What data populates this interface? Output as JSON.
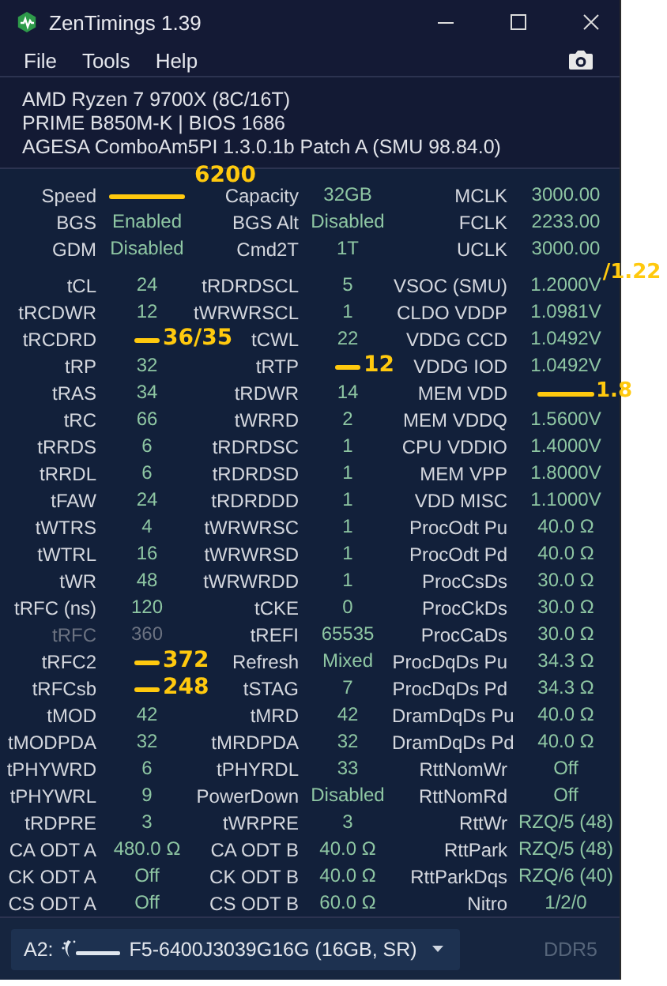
{
  "window": {
    "title": "ZenTimings 1.39"
  },
  "menu": [
    "File",
    "Tools",
    "Help"
  ],
  "system_info": [
    "AMD Ryzen 7 9700X (8C/16T)",
    "PRIME B850M-K | BIOS 1686",
    "AGESA ComboAm5PI 1.3.0.1b Patch A (SMU 98.84.0)"
  ],
  "summary_rows": [
    [
      {
        "label": "Speed",
        "kind": "struck",
        "note": "6200"
      },
      {
        "label": "Capacity",
        "value": "32GB",
        "kind": "plain"
      },
      {
        "label": "MCLK",
        "value": "3000.00",
        "kind": "plain"
      }
    ],
    [
      {
        "label": "BGS",
        "value": "Enabled",
        "kind": "plain"
      },
      {
        "label": "BGS Alt",
        "value": "Disabled",
        "kind": "plain"
      },
      {
        "label": "FCLK",
        "value": "2233.00",
        "kind": "plain"
      }
    ],
    [
      {
        "label": "GDM",
        "value": "Disabled",
        "kind": "plain"
      },
      {
        "label": "Cmd2T",
        "value": "1T",
        "kind": "plain"
      },
      {
        "label": "UCLK",
        "value": "3000.00",
        "kind": "plain"
      }
    ]
  ],
  "timing_rows": [
    [
      {
        "label": "tCL",
        "value": "24",
        "kind": "plain"
      },
      {
        "label": "tRDRDSCL",
        "value": "5",
        "kind": "plain"
      },
      {
        "label": "VSOC (SMU)",
        "value": "1.2000V",
        "kind": "plain",
        "note": "/1.22"
      }
    ],
    [
      {
        "label": "tRCDWR",
        "value": "12",
        "kind": "plain"
      },
      {
        "label": "tWRWRSCL",
        "value": "1",
        "kind": "plain"
      },
      {
        "label": "CLDO VDDP",
        "value": "1.0981V",
        "kind": "plain"
      }
    ],
    [
      {
        "label": "tRCDRD",
        "kind": "struck",
        "note": "36/35"
      },
      {
        "label": "tCWL",
        "value": "22",
        "kind": "plain"
      },
      {
        "label": "VDDG CCD",
        "value": "1.0492V",
        "kind": "plain"
      }
    ],
    [
      {
        "label": "tRP",
        "value": "32",
        "kind": "plain"
      },
      {
        "label": "tRTP",
        "kind": "struck",
        "note": "12"
      },
      {
        "label": "VDDG IOD",
        "value": "1.0492V",
        "kind": "plain"
      }
    ],
    [
      {
        "label": "tRAS",
        "value": "34",
        "kind": "plain"
      },
      {
        "label": "tRDWR",
        "value": "14",
        "kind": "plain"
      },
      {
        "label": "MEM VDD",
        "kind": "struck",
        "note": "1.8"
      }
    ],
    [
      {
        "label": "tRC",
        "value": "66",
        "kind": "plain"
      },
      {
        "label": "tWRRD",
        "value": "2",
        "kind": "plain"
      },
      {
        "label": "MEM VDDQ",
        "value": "1.5600V",
        "kind": "plain"
      }
    ],
    [
      {
        "label": "tRRDS",
        "value": "6",
        "kind": "plain"
      },
      {
        "label": "tRDRDSC",
        "value": "1",
        "kind": "plain"
      },
      {
        "label": "CPU VDDIO",
        "value": "1.4000V",
        "kind": "plain"
      }
    ],
    [
      {
        "label": "tRRDL",
        "value": "6",
        "kind": "plain"
      },
      {
        "label": "tRDRDSD",
        "value": "1",
        "kind": "plain"
      },
      {
        "label": "MEM VPP",
        "value": "1.8000V",
        "kind": "plain"
      }
    ],
    [
      {
        "label": "tFAW",
        "value": "24",
        "kind": "plain"
      },
      {
        "label": "tRDRDDD",
        "value": "1",
        "kind": "plain"
      },
      {
        "label": "VDD MISC",
        "value": "1.1000V",
        "kind": "plain"
      }
    ],
    [
      {
        "label": "tWTRS",
        "value": "4",
        "kind": "plain"
      },
      {
        "label": "tWRWRSC",
        "value": "1",
        "kind": "plain"
      },
      {
        "label": "ProcOdt Pu",
        "value": "40.0 Ω",
        "kind": "plain"
      }
    ],
    [
      {
        "label": "tWTRL",
        "value": "16",
        "kind": "plain"
      },
      {
        "label": "tWRWRSD",
        "value": "1",
        "kind": "plain"
      },
      {
        "label": "ProcOdt Pd",
        "value": "40.0 Ω",
        "kind": "plain"
      }
    ],
    [
      {
        "label": "tWR",
        "value": "48",
        "kind": "plain"
      },
      {
        "label": "tWRWRDD",
        "value": "1",
        "kind": "plain"
      },
      {
        "label": "ProcCsDs",
        "value": "30.0 Ω",
        "kind": "plain"
      }
    ],
    [
      {
        "label": "tRFC (ns)",
        "value": "120",
        "kind": "plain"
      },
      {
        "label": "tCKE",
        "value": "0",
        "kind": "plain"
      },
      {
        "label": "ProcCkDs",
        "value": "30.0 Ω",
        "kind": "plain"
      }
    ],
    [
      {
        "label": "tRFC",
        "value": "360",
        "kind": "disabled"
      },
      {
        "label": "tREFI",
        "value": "65535",
        "kind": "plain"
      },
      {
        "label": "ProcCaDs",
        "value": "30.0 Ω",
        "kind": "plain"
      }
    ],
    [
      {
        "label": "tRFC2",
        "kind": "struck",
        "note": "372"
      },
      {
        "label": "Refresh",
        "value": "Mixed",
        "kind": "plain"
      },
      {
        "label": "ProcDqDs Pu",
        "value": "34.3 Ω",
        "kind": "plain"
      }
    ],
    [
      {
        "label": "tRFCsb",
        "kind": "struck",
        "note": "248"
      },
      {
        "label": "tSTAG",
        "value": "7",
        "kind": "plain"
      },
      {
        "label": "ProcDqDs Pd",
        "value": "34.3 Ω",
        "kind": "plain"
      }
    ],
    [
      {
        "label": "tMOD",
        "value": "42",
        "kind": "plain"
      },
      {
        "label": "tMRD",
        "value": "42",
        "kind": "plain"
      },
      {
        "label": "DramDqDs Pu",
        "value": "40.0 Ω",
        "kind": "plain"
      }
    ],
    [
      {
        "label": "tMODPDA",
        "value": "32",
        "kind": "plain"
      },
      {
        "label": "tMRDPDA",
        "value": "32",
        "kind": "plain"
      },
      {
        "label": "DramDqDs Pd",
        "value": "40.0 Ω",
        "kind": "plain"
      }
    ],
    [
      {
        "label": "tPHYWRD",
        "value": "6",
        "kind": "plain"
      },
      {
        "label": "tPHYRDL",
        "value": "33",
        "kind": "plain"
      },
      {
        "label": "RttNomWr",
        "value": "Off",
        "kind": "plain"
      }
    ],
    [
      {
        "label": "tPHYWRL",
        "value": "9",
        "kind": "plain"
      },
      {
        "label": "PowerDown",
        "value": "Disabled",
        "kind": "plain"
      },
      {
        "label": "RttNomRd",
        "value": "Off",
        "kind": "plain"
      }
    ],
    [
      {
        "label": "tRDPRE",
        "value": "3",
        "kind": "plain"
      },
      {
        "label": "tWRPRE",
        "value": "3",
        "kind": "plain"
      },
      {
        "label": "RttWr",
        "value": "RZQ/5 (48)",
        "kind": "plain"
      }
    ],
    [
      {
        "label": "CA ODT A",
        "value": "480.0 Ω",
        "kind": "plain"
      },
      {
        "label": "CA ODT B",
        "value": "40.0 Ω",
        "kind": "plain"
      },
      {
        "label": "RttPark",
        "value": "RZQ/5 (48)",
        "kind": "plain"
      }
    ],
    [
      {
        "label": "CK ODT A",
        "value": "Off",
        "kind": "plain"
      },
      {
        "label": "CK ODT B",
        "value": "40.0 Ω",
        "kind": "plain"
      },
      {
        "label": "RttParkDqs",
        "value": "RZQ/6 (40)",
        "kind": "plain"
      }
    ],
    [
      {
        "label": "CS ODT A",
        "value": "Off",
        "kind": "plain"
      },
      {
        "label": "CS ODT B",
        "value": "60.0 Ω",
        "kind": "plain"
      },
      {
        "label": "Nitro",
        "value": "1/2/0",
        "kind": "plain"
      }
    ]
  ],
  "footer": {
    "slot": "A2:",
    "module": "F5-6400J3039G16G (16GB, SR)",
    "memory_type": "DDR5"
  }
}
